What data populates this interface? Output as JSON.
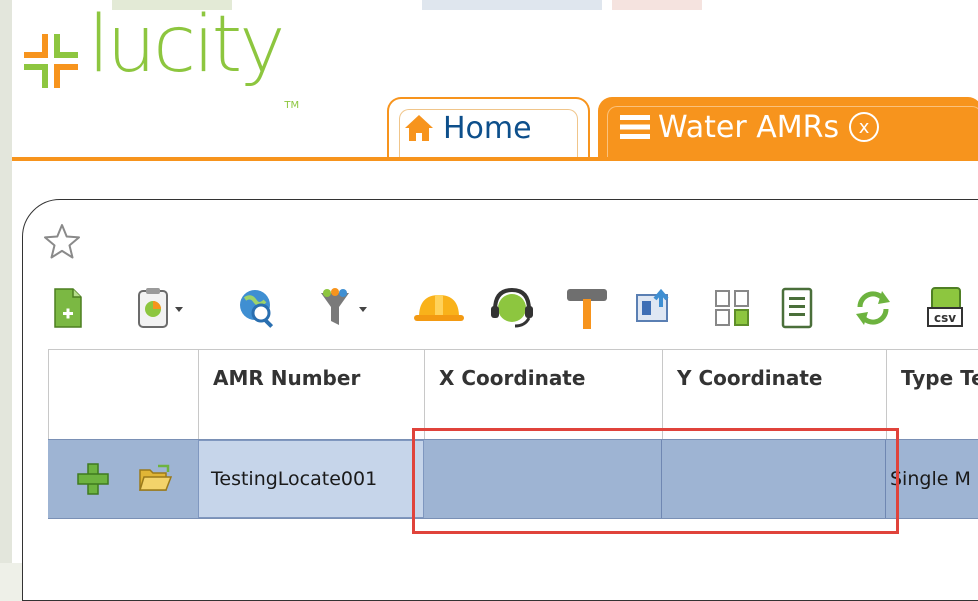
{
  "brand": {
    "logo_text": "lucity",
    "logo_tm": "TM",
    "accent": "#f7941d",
    "logo_green": "#8dc63f"
  },
  "tabs": [
    {
      "label": "Home",
      "icon": "home-icon",
      "active": false
    },
    {
      "label": "Water AMRs",
      "icon": "list-icon",
      "active": true,
      "close_label": "x"
    }
  ],
  "toolbar": {
    "favorite_icon": "star-outline-icon",
    "tools": [
      "add-record-icon",
      "dashboard-dropdown-icon",
      "map-search-icon",
      "filter-dropdown-icon",
      "work-helmet-icon",
      "support-headset-icon",
      "hammer-icon",
      "export-icon",
      "copy-records-icon",
      "report-icon",
      "refresh-icon",
      "csv-export-icon"
    ]
  },
  "grid": {
    "columns": [
      {
        "key": "actions",
        "label": ""
      },
      {
        "key": "amr_number",
        "label": "AMR Number"
      },
      {
        "key": "x_coordinate",
        "label": "X Coordinate"
      },
      {
        "key": "y_coordinate",
        "label": "Y Coordinate"
      },
      {
        "key": "type",
        "label": "Type Te"
      }
    ],
    "rows": [
      {
        "amr_number": "TestingLocate001",
        "x_coordinate": "",
        "y_coordinate": "",
        "type": "Single M"
      }
    ],
    "selected_row_color": "#9eb4d3",
    "highlight_color": "#e0433b"
  }
}
